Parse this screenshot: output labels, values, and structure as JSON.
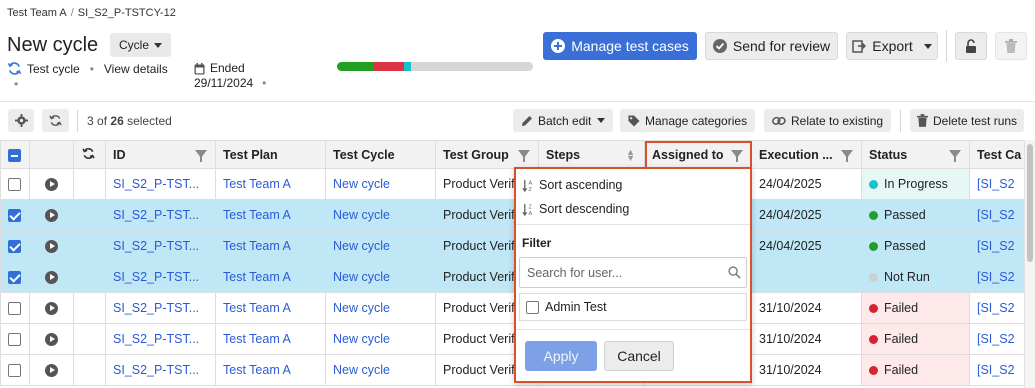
{
  "breadcrumb": [
    "Test Team A",
    "SI_S2_P-TSTCY-12"
  ],
  "title": "New cycle",
  "cycle_pill": "Cycle",
  "meta": {
    "type": "Test cycle",
    "view_details": "View details",
    "status_label": "Ended",
    "end_date": "29/11/2024"
  },
  "progress": [
    {
      "color": "#22a022",
      "fraction": 0.19
    },
    {
      "color": "#d93344",
      "fraction": 0.15
    },
    {
      "color": "#1bc1c9",
      "fraction": 0.04
    },
    {
      "color": "#d6d6d6",
      "fraction": 0.62
    }
  ],
  "actions": {
    "manage": "Manage test cases",
    "send": "Send for review",
    "export": "Export"
  },
  "toolbar": {
    "selected_count": "3",
    "selected_of": "of",
    "selected_total": "26",
    "selected_suffix": "selected",
    "batch": "Batch edit",
    "categories": "Manage categories",
    "relate": "Relate to existing",
    "delete": "Delete test runs"
  },
  "columns": [
    "ID",
    "Test Plan",
    "Test Cycle",
    "Test Group",
    "Steps",
    "Assigned to",
    "Execution ...",
    "Status",
    "Test Ca"
  ],
  "rows": [
    {
      "id": "SI_S2_P-TST...",
      "plan": "Test Team A",
      "cycle": "New cycle",
      "group": "Product Verifi",
      "exec": "24/04/2025",
      "status": "In Progress",
      "tc": "[SI_S2"
    },
    {
      "id": "SI_S2_P-TST...",
      "plan": "Test Team A",
      "cycle": "New cycle",
      "group": "Product Verifi",
      "exec": "24/04/2025",
      "status": "Passed",
      "tc": "[SI_S2"
    },
    {
      "id": "SI_S2_P-TST...",
      "plan": "Test Team A",
      "cycle": "New cycle",
      "group": "Product Verifi",
      "exec": "24/04/2025",
      "status": "Passed",
      "tc": "[SI_S2"
    },
    {
      "id": "SI_S2_P-TST...",
      "plan": "Test Team A",
      "cycle": "New cycle",
      "group": "Product Verifi",
      "exec": "",
      "status": "Not Run",
      "tc": "[SI_S2"
    },
    {
      "id": "SI_S2_P-TST...",
      "plan": "Test Team A",
      "cycle": "New cycle",
      "group": "Product Verifi",
      "exec": "31/10/2024",
      "status": "Failed",
      "tc": "[SI_S2"
    },
    {
      "id": "SI_S2_P-TST...",
      "plan": "Test Team A",
      "cycle": "New cycle",
      "group": "Product Verifi",
      "exec": "31/10/2024",
      "status": "Failed",
      "tc": "[SI_S2"
    },
    {
      "id": "SI_S2_P-TST...",
      "plan": "Test Team A",
      "cycle": "New cycle",
      "group": "Product Verifi",
      "exec": "31/10/2024",
      "status": "Failed",
      "tc": "[SI_S2"
    }
  ],
  "selected_rows": [
    1,
    2,
    3
  ],
  "status_colors": {
    "In Progress": "#1bc1c9",
    "Passed": "#1f9e2c",
    "Not Run": "#cfcfcf",
    "Failed": "#d9232e"
  },
  "popup": {
    "sort_asc": "Sort ascending",
    "sort_desc": "Sort descending",
    "filter_title": "Filter",
    "search_placeholder": "Search for user...",
    "user_option": "Admin Test",
    "apply": "Apply",
    "cancel": "Cancel"
  },
  "accent": "#3a6fd8",
  "highlight": "#d9512c"
}
